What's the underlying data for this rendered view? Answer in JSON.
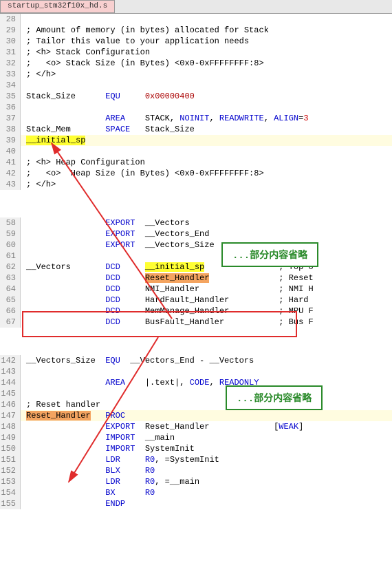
{
  "tab": {
    "label": "startup_stm32f10x_hd.s"
  },
  "gutter": {
    "g28": "28",
    "g29": "29",
    "g30": "30",
    "g31": "31",
    "g32": "32",
    "g33": "33",
    "g34": "34",
    "g35": "35",
    "g36": "36",
    "g37": "37",
    "g38": "38",
    "g39": "39",
    "g40": "40",
    "g41": "41",
    "g42": "42",
    "g43": "43",
    "g58": "58",
    "g59": "59",
    "g60": "60",
    "g61": "61",
    "g62": "62",
    "g63": "63",
    "g64": "64",
    "g65": "65",
    "g66": "66",
    "g67": "67",
    "g142": "142",
    "g143": "143",
    "g144": "144",
    "g145": "145",
    "g146": "146",
    "g147": "147",
    "g148": "148",
    "g149": "149",
    "g150": "150",
    "g151": "151",
    "g152": "152",
    "g153": "153",
    "g154": "154",
    "g155": "155"
  },
  "c29": "; Amount of memory (in bytes) allocated for Stack",
  "c30": "; Tailor this value to your application needs",
  "c31": "; <h> Stack Configuration",
  "c32": ";   <o> Stack Size (in Bytes) <0x0-0xFFFFFFFF:8>",
  "c33": "; </h>",
  "c35a": "Stack_Size      ",
  "c35b": "EQU",
  "c35c": "     ",
  "c35d": "0x00000400",
  "c37a": "                ",
  "c37b": "AREA",
  "c37c": "    STACK, ",
  "c37d": "NOINIT",
  "c37e": ", ",
  "c37f": "READWRITE",
  "c37g": ", ",
  "c37h": "ALIGN",
  "c37i": "=",
  "c37j": "3",
  "c38a": "Stack_Mem       ",
  "c38b": "SPACE",
  "c38c": "   Stack_Size",
  "c39": "__initial_sp",
  "c41": "; <h> Heap Configuration",
  "c42": ";   <o>  Heap Size (in Bytes) <0x0-0xFFFFFFFF:8>",
  "c43": "; </h>",
  "omit1": "...部分内容省略",
  "c58a": "                ",
  "c58b": "EXPORT",
  "c58c": "  __Vectors",
  "c59a": "                ",
  "c59b": "EXPORT",
  "c59c": "  __Vectors_End",
  "c60a": "                ",
  "c60b": "EXPORT",
  "c60c": "  __Vectors_Size",
  "c62a": "__Vectors       ",
  "c62b": "DCD",
  "c62c": "     ",
  "c62d": "__initial_sp",
  "c62e": "               ; Top o",
  "c63a": "                ",
  "c63b": "DCD",
  "c63c": "     ",
  "c63d": "Reset_Handler",
  "c63e": "              ; Reset",
  "c64a": "                ",
  "c64b": "DCD",
  "c64c": "     NMI_Handler                ; NMI H",
  "c65a": "                ",
  "c65b": "DCD",
  "c65c": "     HardFault_Handler          ; Hard ",
  "c66a": "                ",
  "c66b": "DCD",
  "c66c": "     MemManage_Handler          ; MPU F",
  "c67a": "                ",
  "c67b": "DCD",
  "c67c": "     BusFault_Handler           ; Bus F",
  "omit2": "...部分内容省略",
  "c142a": "__Vectors_Size  ",
  "c142b": "EQU",
  "c142c": "  __Vectors_End - __Vectors",
  "c144a": "                ",
  "c144b": "AREA",
  "c144c": "    |.text|, ",
  "c144d": "CODE",
  "c144e": ", ",
  "c144f": "READONLY",
  "c146": "; Reset handler",
  "c147a": "Reset_Handler",
  "c147b": "   ",
  "c147c": "PROC",
  "c148a": "                ",
  "c148b": "EXPORT",
  "c148c": "  Reset_Handler             [",
  "c148d": "WEAK",
  "c148e": "]",
  "c149a": "                ",
  "c149b": "IMPORT",
  "c149c": "  __main",
  "c150a": "                ",
  "c150b": "IMPORT",
  "c150c": "  SystemInit",
  "c151a": "                ",
  "c151b": "LDR",
  "c151c": "     ",
  "c151d": "R0",
  "c151e": ", =SystemInit",
  "c152a": "                ",
  "c152b": "BLX",
  "c152c": "     ",
  "c152d": "R0",
  "c153a": "                ",
  "c153b": "LDR",
  "c153c": "     ",
  "c153d": "R0",
  "c153e": ", =__main",
  "c154a": "                ",
  "c154b": "BX",
  "c154c": "      ",
  "c154d": "R0",
  "c155a": "                ",
  "c155b": "ENDP"
}
